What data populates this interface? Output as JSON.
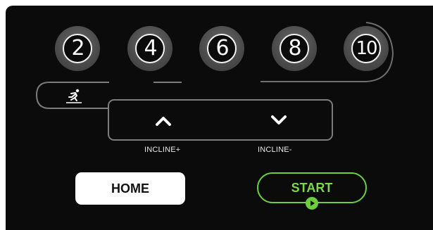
{
  "speed_presets": [
    "2",
    "4",
    "6",
    "8",
    "10"
  ],
  "incline": {
    "up_label": "INCLINE+",
    "down_label": "INCLINE-"
  },
  "buttons": {
    "home": "HOME",
    "start": "START"
  },
  "colors": {
    "background": "#0b0b0b",
    "accent_green": "#6ccf3b",
    "outline_gray": "#7c7c7c"
  },
  "icons": {
    "runner": "runner-icon",
    "incline_up": "chevron-up-icon",
    "incline_down": "chevron-down-icon",
    "play": "play-icon"
  }
}
